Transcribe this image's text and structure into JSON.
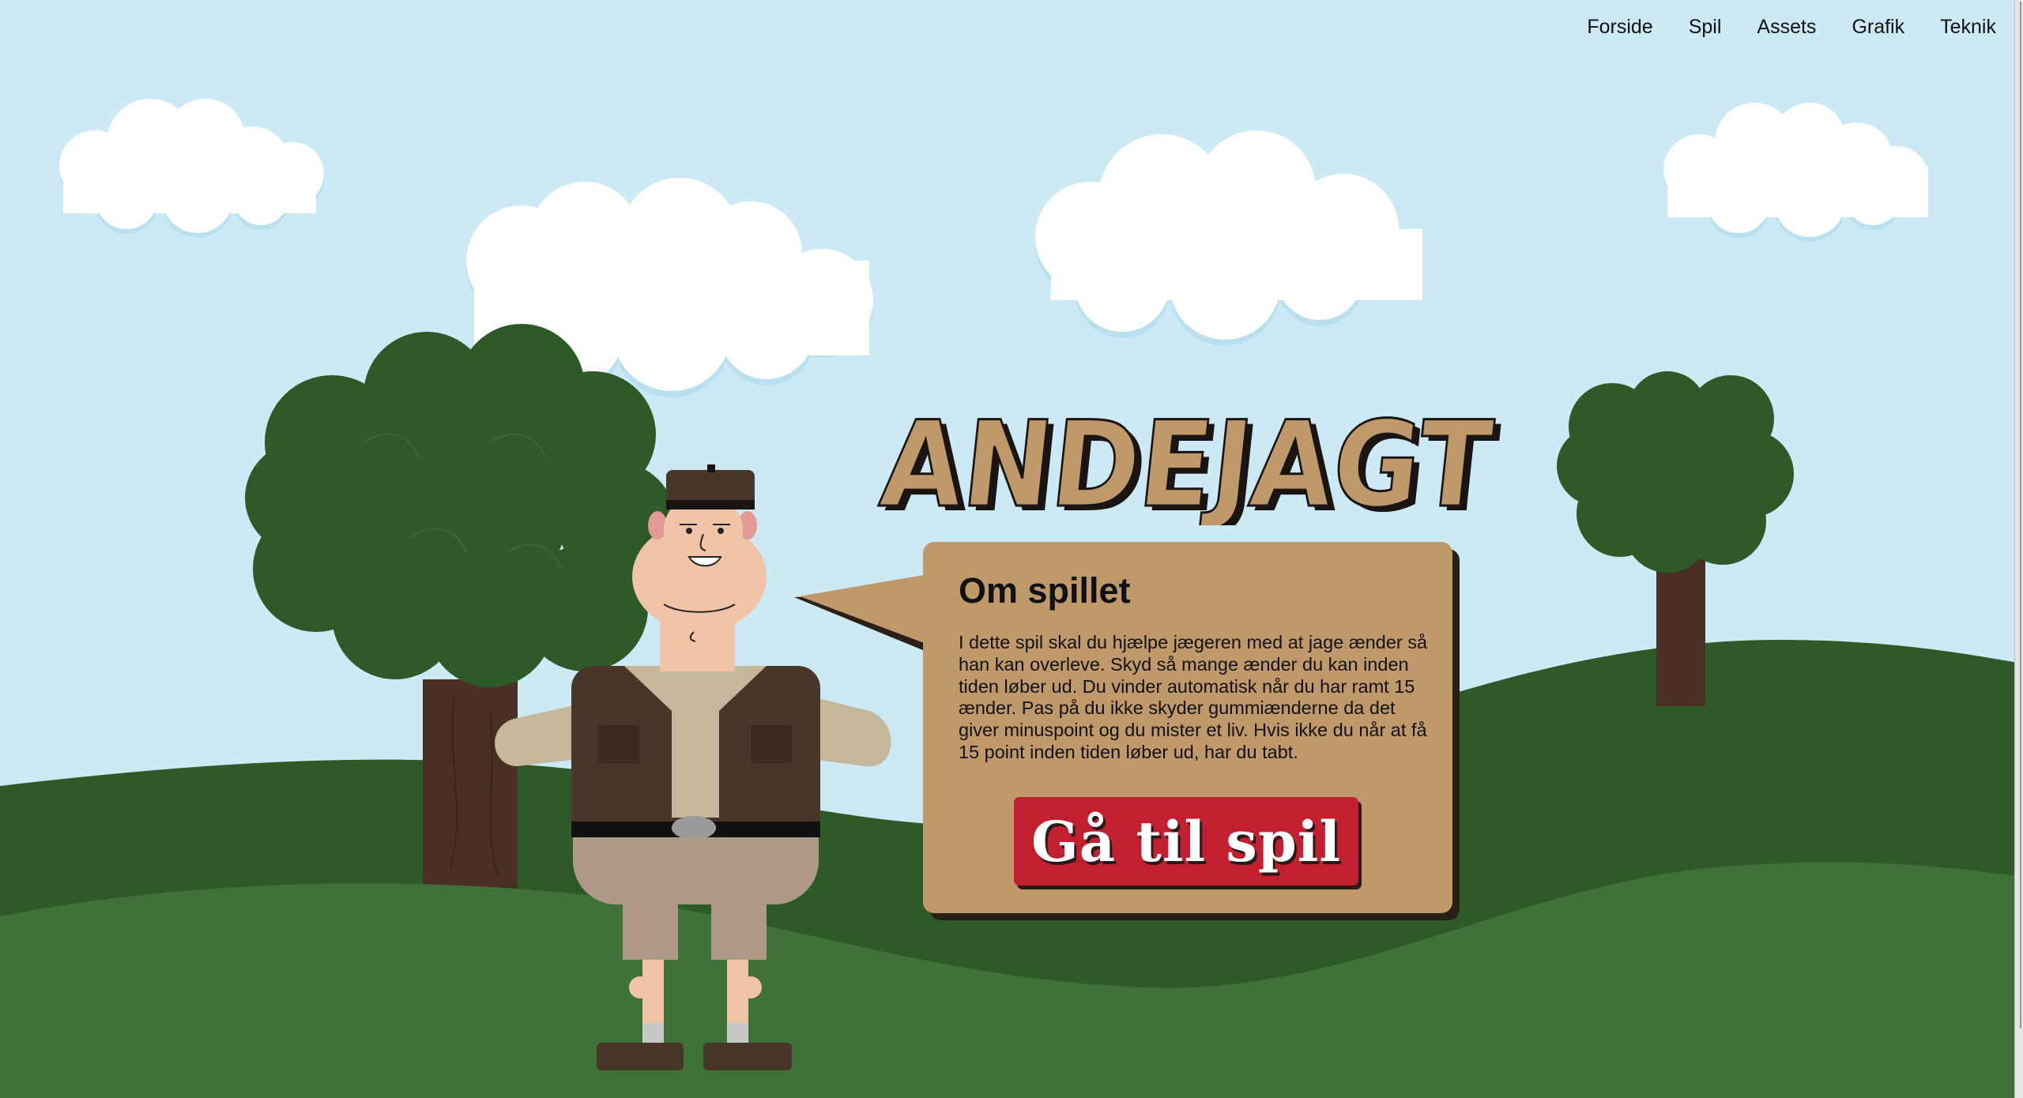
{
  "nav": {
    "items": [
      {
        "label": "Forside"
      },
      {
        "label": "Spil"
      },
      {
        "label": "Assets"
      },
      {
        "label": "Grafik"
      },
      {
        "label": "Teknik"
      }
    ]
  },
  "logo": {
    "title": "ANDEJAGT"
  },
  "about": {
    "heading": "Om spillet",
    "body": "I dette spil skal du hjælpe jægeren med at jage ænder så han kan overleve. Skyd så mange ænder du kan inden tiden løber ud. Du vinder automatisk når du har ramt 15 ænder. Pas på du ikke skyder gummiænderne da det giver minuspoint og du mister et liv. Hvis ikke du når at få 15 point inden tiden løber ud, har du tabt.",
    "play_label": "Gå til spil"
  },
  "colors": {
    "sky": "#cbeaf5",
    "panel": "#c0996a",
    "play_button": "#c21f30",
    "hill_dark": "#2e5a28",
    "hill_light": "#3e7236",
    "tree_leaves": "#2e5a28",
    "tree_trunk": "#4a3024"
  },
  "icons": {
    "hunter": "hunter-character-illustration",
    "cloud": "cloud-illustration",
    "tree": "tree-illustration"
  }
}
